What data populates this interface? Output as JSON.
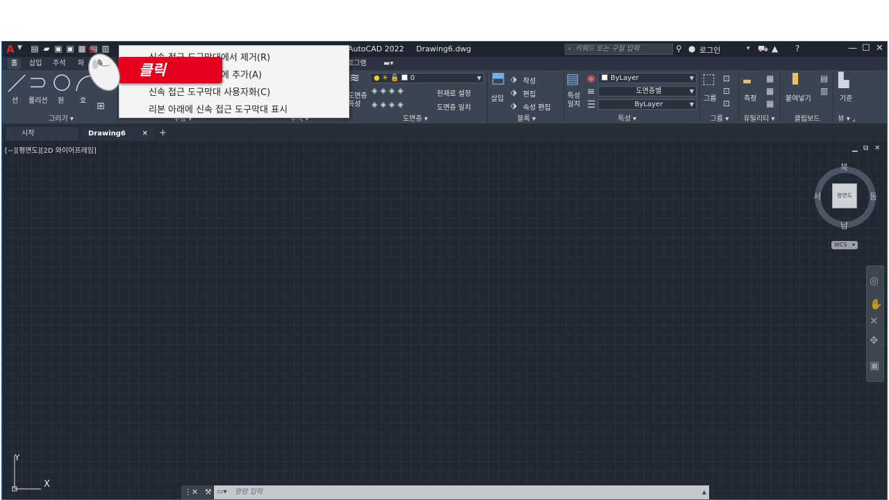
{
  "titlebar": {
    "app_title": "AutoCAD 2022",
    "file_name": "Drawing6.dwg",
    "search_placeholder": "키워드 또는 구절 입력",
    "login": "로그인"
  },
  "ribbon_tabs": [
    "홈",
    "삽입",
    "주석",
    "파",
    "로그램"
  ],
  "draw_panel": {
    "tools": [
      "선",
      "폴리선",
      "원",
      "호"
    ],
    "label": "그리기"
  },
  "hidden_panel_labels": [
    "수정",
    "주석"
  ],
  "layer_panel": {
    "layer_prop": "도면층 특성",
    "layer_name": "0",
    "set_current": "현재로 설정",
    "match_layer": "도면층 일치",
    "label": "도면층"
  },
  "block_panel": {
    "insert": "삽입",
    "create": "작성",
    "edit": "편집",
    "attr_edit": "속성 편집",
    "label": "블록"
  },
  "properties_panel": {
    "match": "특성 일치",
    "color": "ByLayer",
    "linetype": "도면층별",
    "lineweight": "ByLayer",
    "label": "특성"
  },
  "groups_panel": {
    "group": "그룹",
    "label": "그룹"
  },
  "utilities_panel": {
    "measure": "측정",
    "label": "유틸리티"
  },
  "clipboard_panel": {
    "paste": "붙여넣기",
    "label": "클립보드"
  },
  "view_panel": {
    "base": "기준",
    "label": "뷰"
  },
  "doc_tabs": {
    "start": "시작",
    "active": "Drawing6",
    "add": "+"
  },
  "viewport": {
    "label": "[−][평면도][2D 와이어프레임]"
  },
  "viewcube": {
    "north": "북",
    "south": "남",
    "east": "동",
    "west": "서",
    "face": "평면도",
    "wcs": "WCS"
  },
  "ucs": {
    "x": "X",
    "y": "Y"
  },
  "command_line": {
    "placeholder": "명령 입력"
  },
  "context_menu": {
    "items": [
      "신속 접근 도구막대에서 제거(R)",
      "신속 접근 도구막대에 추가(A)",
      "신속 접근 도구막대 사용자화(C)",
      "리본 아래에 신속 접근 도구막대 표시"
    ]
  },
  "callout": {
    "text": "클릭"
  },
  "colors": {
    "accent_red": "#e4001c",
    "ribbon_bg": "#3b4452",
    "canvas_bg": "#212833"
  }
}
